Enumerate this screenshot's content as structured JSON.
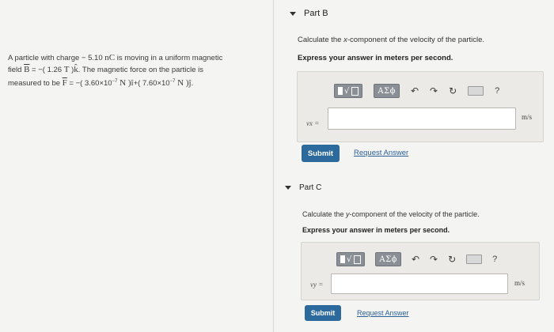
{
  "problem": {
    "line1_a": "A particle with charge − 5.10 ",
    "line1_unit": "nC",
    "line1_b": " is moving in a uniform magnetic",
    "line2_a": "field ",
    "line2_B": "B",
    "line2_eq": " = −( 1.26 ",
    "line2_T": "T",
    "line2_b": " )",
    "line2_k": "k̂",
    "line2_c": ". The magnetic force on the particle is",
    "line3_a": "measured to be ",
    "line3_F": "F",
    "line3_eq": " = −( 3.60×10",
    "line3_exp1": "−7",
    "line3_N1": " N ",
    "line3_i": ")î",
    "line3_plus": "+( 7.60×10",
    "line3_exp2": "−7",
    "line3_N2": " N ",
    "line3_j": ")ĵ",
    "line3_end": "."
  },
  "partB": {
    "title": "Part B",
    "prompt_a": "Calculate the ",
    "prompt_x": "x",
    "prompt_b": "-component of the velocity of the particle.",
    "instruction": "Express your answer in meters per second.",
    "var_label": "vx =",
    "unit": "m/s",
    "input_value": "",
    "submit_label": "Submit",
    "request_label": "Request Answer"
  },
  "partC": {
    "title": "Part C",
    "prompt_a": "Calculate the ",
    "prompt_y": "y",
    "prompt_b": "-component of the velocity of the particle.",
    "instruction": "Express your answer in meters per second.",
    "var_label": "vy =",
    "unit": "m/s",
    "input_value": "",
    "submit_label": "Submit",
    "request_label": "Request Answer"
  },
  "toolbar": {
    "greek_label": "ΑΣϕ",
    "undo_icon": "↶",
    "redo_icon": "↷",
    "reset_icon": "↻",
    "help_label": "?"
  }
}
